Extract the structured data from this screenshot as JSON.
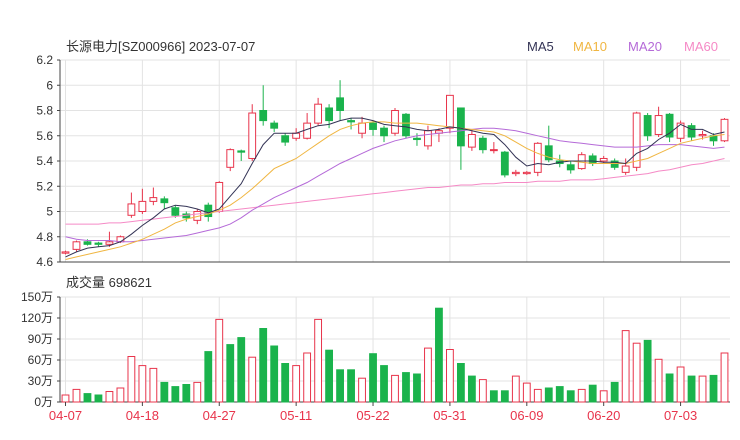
{
  "colors": {
    "up": "#e8344b",
    "down": "#1ab34c",
    "ma5": "#333355",
    "ma10": "#f0b642",
    "ma20": "#b56ad8",
    "ma60": "#f58ac6",
    "axis": "#444444",
    "grid": "#e3e3e3",
    "date": "#e8344b"
  },
  "chart_data": [
    {
      "type": "candlestick",
      "title": "长源电力[SZ000966] 2023-07-07",
      "legend": [
        {
          "key": "ma5",
          "label": "MA5"
        },
        {
          "key": "ma10",
          "label": "MA10"
        },
        {
          "key": "ma20",
          "label": "MA20"
        },
        {
          "key": "ma60",
          "label": "MA60"
        }
      ],
      "legend_position": "top-right",
      "ylim": [
        4.6,
        6.2
      ],
      "yticks": [
        "6.2",
        "6",
        "5.8",
        "5.6",
        "5.4",
        "5.2",
        "5",
        "4.8",
        "4.6"
      ],
      "grid": true,
      "x_tick_labels": [
        {
          "index": 0,
          "label": "04-07"
        },
        {
          "index": 7,
          "label": "04-18"
        },
        {
          "index": 14,
          "label": "04-27"
        },
        {
          "index": 21,
          "label": "05-11"
        },
        {
          "index": 28,
          "label": "05-22"
        },
        {
          "index": 35,
          "label": "05-31"
        },
        {
          "index": 42,
          "label": "06-09"
        },
        {
          "index": 49,
          "label": "06-20"
        },
        {
          "index": 56,
          "label": "07-03"
        }
      ],
      "candles": [
        [
          4.67,
          4.68,
          4.66,
          4.69
        ],
        [
          4.7,
          4.76,
          4.68,
          4.77
        ],
        [
          4.76,
          4.74,
          4.73,
          4.78
        ],
        [
          4.75,
          4.74,
          4.72,
          4.76
        ],
        [
          4.74,
          4.76,
          4.72,
          4.84
        ],
        [
          4.76,
          4.8,
          4.75,
          4.81
        ],
        [
          4.97,
          5.06,
          4.95,
          5.15
        ],
        [
          5.0,
          5.08,
          4.98,
          5.18
        ],
        [
          5.08,
          5.11,
          5.05,
          5.19
        ],
        [
          5.1,
          5.07,
          5.02,
          5.12
        ],
        [
          5.03,
          4.97,
          4.95,
          5.05
        ],
        [
          4.98,
          4.95,
          4.92,
          5.0
        ],
        [
          4.93,
          5.0,
          4.9,
          5.02
        ],
        [
          5.05,
          4.96,
          4.92,
          5.07
        ],
        [
          5.0,
          5.23,
          4.99,
          5.24
        ],
        [
          5.35,
          5.49,
          5.32,
          5.5
        ],
        [
          5.48,
          5.47,
          5.4,
          5.49
        ],
        [
          5.42,
          5.78,
          5.4,
          5.85
        ],
        [
          5.8,
          5.72,
          5.68,
          6.0
        ],
        [
          5.7,
          5.66,
          5.63,
          5.72
        ],
        [
          5.6,
          5.55,
          5.52,
          5.62
        ],
        [
          5.58,
          5.62,
          5.56,
          5.66
        ],
        [
          5.58,
          5.7,
          5.57,
          5.78
        ],
        [
          5.7,
          5.85,
          5.68,
          5.9
        ],
        [
          5.82,
          5.72,
          5.66,
          5.85
        ],
        [
          5.9,
          5.8,
          5.72,
          6.04
        ],
        [
          5.72,
          5.71,
          5.65,
          5.74
        ],
        [
          5.62,
          5.7,
          5.58,
          5.75
        ],
        [
          5.7,
          5.65,
          5.6,
          5.72
        ],
        [
          5.66,
          5.6,
          5.55,
          5.68
        ],
        [
          5.62,
          5.8,
          5.6,
          5.82
        ],
        [
          5.77,
          5.6,
          5.58,
          5.78
        ],
        [
          5.58,
          5.57,
          5.52,
          5.62
        ],
        [
          5.52,
          5.64,
          5.49,
          5.68
        ],
        [
          5.62,
          5.64,
          5.55,
          5.66
        ],
        [
          5.66,
          5.92,
          5.62,
          5.92
        ],
        [
          5.82,
          5.52,
          5.33,
          5.82
        ],
        [
          5.51,
          5.61,
          5.48,
          5.65
        ],
        [
          5.58,
          5.49,
          5.46,
          5.6
        ],
        [
          5.49,
          5.49,
          5.46,
          5.55
        ],
        [
          5.47,
          5.29,
          5.27,
          5.48
        ],
        [
          5.3,
          5.31,
          5.28,
          5.33
        ],
        [
          5.3,
          5.31,
          5.29,
          5.32
        ],
        [
          5.31,
          5.54,
          5.28,
          5.55
        ],
        [
          5.52,
          5.41,
          5.39,
          5.68
        ],
        [
          5.4,
          5.38,
          5.35,
          5.45
        ],
        [
          5.37,
          5.33,
          5.3,
          5.4
        ],
        [
          5.34,
          5.45,
          5.33,
          5.47
        ],
        [
          5.44,
          5.38,
          5.36,
          5.46
        ],
        [
          5.4,
          5.42,
          5.38,
          5.44
        ],
        [
          5.4,
          5.35,
          5.33,
          5.42
        ],
        [
          5.31,
          5.36,
          5.29,
          5.42
        ],
        [
          5.35,
          5.78,
          5.32,
          5.79
        ],
        [
          5.76,
          5.6,
          5.56,
          5.78
        ],
        [
          5.61,
          5.76,
          5.59,
          5.83
        ],
        [
          5.77,
          5.59,
          5.55,
          5.78
        ],
        [
          5.58,
          5.7,
          5.55,
          5.72
        ],
        [
          5.68,
          5.59,
          5.56,
          5.7
        ],
        [
          5.6,
          5.61,
          5.57,
          5.64
        ],
        [
          5.6,
          5.56,
          5.52,
          5.62
        ],
        [
          5.56,
          5.73,
          5.55,
          5.74
        ]
      ],
      "ma5": [
        4.64,
        4.68,
        4.71,
        4.72,
        4.73,
        4.76,
        4.82,
        4.89,
        4.95,
        5.02,
        5.05,
        5.04,
        5.02,
        4.99,
        5.02,
        5.12,
        5.22,
        5.38,
        5.53,
        5.62,
        5.62,
        5.62,
        5.65,
        5.68,
        5.69,
        5.72,
        5.74,
        5.74,
        5.72,
        5.69,
        5.68,
        5.67,
        5.65,
        5.64,
        5.65,
        5.67,
        5.66,
        5.64,
        5.62,
        5.61,
        5.53,
        5.43,
        5.36,
        5.38,
        5.37,
        5.39,
        5.4,
        5.4,
        5.4,
        5.39,
        5.39,
        5.38,
        5.46,
        5.5,
        5.57,
        5.62,
        5.69,
        5.65,
        5.65,
        5.61,
        5.63
      ],
      "ma10": [
        4.62,
        4.64,
        4.66,
        4.68,
        4.7,
        4.72,
        4.75,
        4.78,
        4.82,
        4.86,
        4.91,
        4.94,
        4.96,
        4.98,
        5.01,
        5.05,
        5.11,
        5.18,
        5.26,
        5.34,
        5.38,
        5.42,
        5.48,
        5.54,
        5.6,
        5.65,
        5.68,
        5.7,
        5.71,
        5.71,
        5.7,
        5.7,
        5.7,
        5.69,
        5.68,
        5.67,
        5.66,
        5.65,
        5.64,
        5.63,
        5.6,
        5.55,
        5.5,
        5.46,
        5.43,
        5.41,
        5.4,
        5.39,
        5.38,
        5.38,
        5.38,
        5.38,
        5.4,
        5.42,
        5.46,
        5.5,
        5.54,
        5.56,
        5.58,
        5.6,
        5.61
      ],
      "ma20": [
        4.8,
        4.78,
        4.77,
        4.77,
        4.77,
        4.76,
        4.76,
        4.77,
        4.78,
        4.79,
        4.8,
        4.81,
        4.83,
        4.85,
        4.87,
        4.9,
        4.95,
        5.01,
        5.06,
        5.11,
        5.15,
        5.19,
        5.23,
        5.28,
        5.33,
        5.38,
        5.42,
        5.46,
        5.5,
        5.53,
        5.56,
        5.58,
        5.6,
        5.61,
        5.62,
        5.63,
        5.64,
        5.65,
        5.66,
        5.66,
        5.65,
        5.64,
        5.62,
        5.6,
        5.58,
        5.56,
        5.55,
        5.54,
        5.53,
        5.52,
        5.51,
        5.51,
        5.51,
        5.52,
        5.53,
        5.53,
        5.53,
        5.52,
        5.51,
        5.5,
        5.51
      ],
      "ma60": [
        4.9,
        4.9,
        4.9,
        4.9,
        4.91,
        4.91,
        4.92,
        4.93,
        4.94,
        4.95,
        4.96,
        4.97,
        4.98,
        4.99,
        5.0,
        5.01,
        5.02,
        5.03,
        5.04,
        5.05,
        5.06,
        5.07,
        5.08,
        5.09,
        5.1,
        5.11,
        5.12,
        5.13,
        5.14,
        5.15,
        5.16,
        5.17,
        5.18,
        5.19,
        5.19,
        5.2,
        5.21,
        5.21,
        5.22,
        5.22,
        5.23,
        5.23,
        5.23,
        5.24,
        5.24,
        5.24,
        5.25,
        5.25,
        5.25,
        5.26,
        5.27,
        5.28,
        5.29,
        5.3,
        5.32,
        5.33,
        5.35,
        5.37,
        5.38,
        5.4,
        5.42
      ]
    },
    {
      "type": "bar",
      "title": "成交量 698621",
      "ylim": [
        0,
        150
      ],
      "yticks": [
        "150万",
        "120万",
        "90万",
        "60万",
        "30万",
        "0万"
      ],
      "values": [
        10,
        18,
        12,
        10,
        15,
        20,
        65,
        52,
        48,
        28,
        22,
        25,
        28,
        72,
        118,
        82,
        92,
        64,
        105,
        80,
        55,
        52,
        70,
        118,
        74,
        46,
        46,
        34,
        69,
        52,
        38,
        42,
        40,
        77,
        134,
        75,
        55,
        37,
        32,
        16,
        16,
        37,
        27,
        18,
        20,
        22,
        16,
        18,
        24,
        16,
        28,
        102,
        84,
        88,
        61,
        40,
        50,
        37,
        37,
        38,
        70
      ],
      "up_flags": [
        1,
        1,
        0,
        0,
        1,
        1,
        1,
        1,
        1,
        0,
        0,
        0,
        1,
        0,
        1,
        0,
        0,
        1,
        0,
        0,
        0,
        1,
        1,
        1,
        0,
        0,
        0,
        1,
        0,
        0,
        1,
        0,
        0,
        1,
        0,
        1,
        0,
        0,
        1,
        0,
        0,
        1,
        1,
        1,
        0,
        0,
        0,
        1,
        0,
        1,
        0,
        1,
        1,
        0,
        1,
        0,
        1,
        0,
        1,
        0,
        1
      ]
    }
  ]
}
